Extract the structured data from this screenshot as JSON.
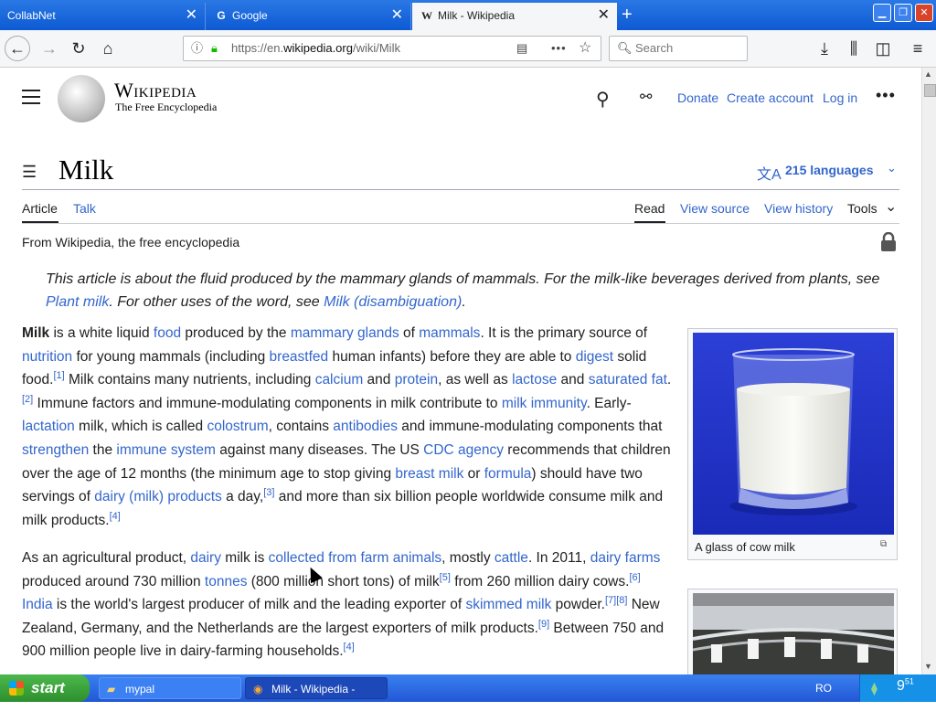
{
  "browser": {
    "tabs": [
      {
        "label": "CollabNet",
        "favicon": ""
      },
      {
        "label": "Google",
        "favicon": "G"
      },
      {
        "label": "Milk - Wikipedia",
        "favicon": "W"
      }
    ],
    "url_prefix": "https://en.",
    "url_domain": "wikipedia.org",
    "url_path": "/wiki/Milk",
    "search_placeholder": "Search"
  },
  "wiki": {
    "wordmark": "Wikipedia",
    "tagline": "The Free Encyclopedia",
    "header_links": {
      "donate": "Donate",
      "create_account": "Create account",
      "login": "Log in"
    },
    "title": "Milk",
    "languages": "215 languages",
    "tabs_left": [
      "Article",
      "Talk"
    ],
    "tabs_right": [
      "Read",
      "View source",
      "View history",
      "Tools"
    ],
    "from": "From Wikipedia, the free encyclopedia",
    "hatnote": {
      "text1": "This article is about the fluid produced by the mammary glands of mammals. For the milk-like beverages derived from plants, see ",
      "link1": "Plant milk",
      "text2": ". For other uses of the word, see ",
      "link2": "Milk (disambiguation)",
      "text3": "."
    },
    "caption1": "A glass of cow milk"
  },
  "taskbar": {
    "start": "start",
    "items": [
      "mypal",
      "Milk - Wikipedia - Mypal"
    ],
    "lang": "RO",
    "clock": "9"
  },
  "colors": {
    "link": "#3366cc",
    "taskbar": "#2a62dc",
    "start": "#3aa63a"
  }
}
